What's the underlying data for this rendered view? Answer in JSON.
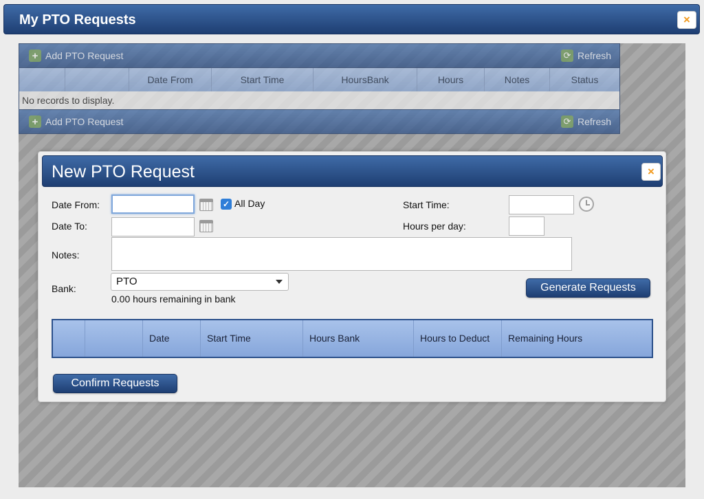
{
  "window": {
    "title": "My PTO Requests",
    "close_icon": "×"
  },
  "grid": {
    "toolbar": {
      "add_label": "Add PTO Request",
      "refresh_label": "Refresh",
      "plus_icon": "+",
      "refresh_icon": "⟳"
    },
    "columns": [
      "",
      "",
      "Date From",
      "Start Time",
      "HoursBank",
      "Hours",
      "Notes",
      "Status"
    ],
    "no_records": "No records to display."
  },
  "modal": {
    "title": "New PTO Request",
    "close_icon": "×",
    "labels": {
      "date_from": "Date From:",
      "date_to": "Date To:",
      "all_day": "All Day",
      "start_time": "Start Time:",
      "hours_per_day": "Hours per day:",
      "notes": "Notes:",
      "bank": "Bank:"
    },
    "values": {
      "date_from": "",
      "date_to": "",
      "start_time": "",
      "hours_per_day": "",
      "notes": "",
      "all_day_checked": true,
      "check_icon": "✓"
    },
    "bank": {
      "selected": "PTO",
      "remaining": "0.00 hours remaining in bank"
    },
    "generate_label": "Generate Requests",
    "confirm_label": "Confirm Requests",
    "req_columns": [
      "",
      "",
      "Date",
      "Start Time",
      "Hours Bank",
      "Hours to Deduct",
      "Remaining Hours"
    ]
  },
  "colors": {
    "header_blue": "#2c5189",
    "accent_orange": "#f29a1e",
    "grid_header": "#98b4e0"
  }
}
